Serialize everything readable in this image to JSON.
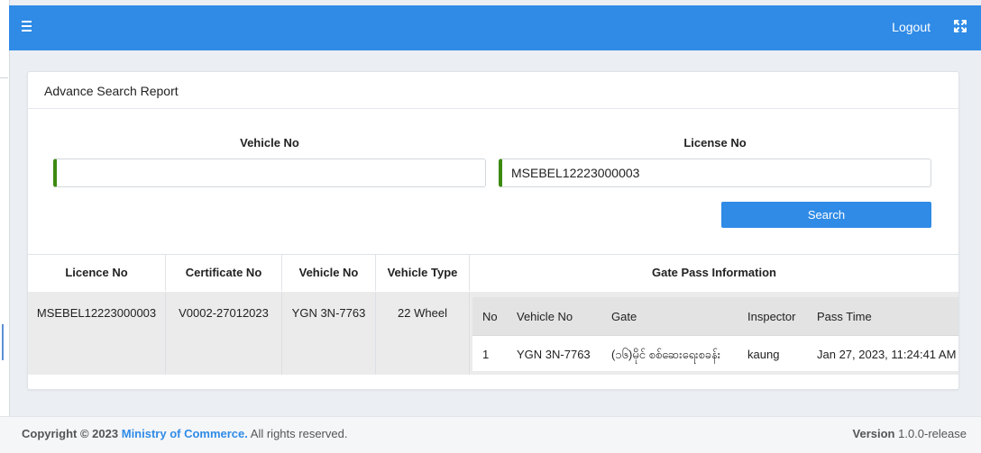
{
  "topbar": {
    "logout_label": "Logout",
    "menu_icon": "hamburger-icon",
    "expand_icon": "fullscreen-icon",
    "color": "#2f8be6"
  },
  "card": {
    "title": "Advance Search Report"
  },
  "form": {
    "vehicle_no_label": "Vehicle No",
    "vehicle_no_value": "",
    "license_no_label": "License No",
    "license_no_value": "MSEBEL12223000003",
    "search_label": "Search",
    "accent": "#3d8a12"
  },
  "results": {
    "columns": [
      "Licence No",
      "Certificate No",
      "Vehicle No",
      "Vehicle Type",
      "Gate Pass Information"
    ],
    "row": {
      "licence_no": "MSEBEL12223000003",
      "certificate_no": "V0002-27012023",
      "vehicle_no": "YGN 3N-7763",
      "vehicle_type": "22 Wheel"
    },
    "gate_pass": {
      "columns": [
        "No",
        "Vehicle No",
        "Gate",
        "Inspector",
        "Pass Time"
      ],
      "rows": [
        {
          "no": "1",
          "vehicle_no": "YGN 3N-7763",
          "gate": "(၁၆)မိုင် စစ်ဆေးရေးစခန်း",
          "inspector": "kaung",
          "pass_time": "Jan 27, 2023, 11:24:41 AM"
        }
      ]
    }
  },
  "footer": {
    "copyright_prefix": "Copyright © 2023",
    "org": "Ministry of Commerce.",
    "rights": "All rights reserved.",
    "version_label": "Version",
    "version_value": "1.0.0-release"
  }
}
